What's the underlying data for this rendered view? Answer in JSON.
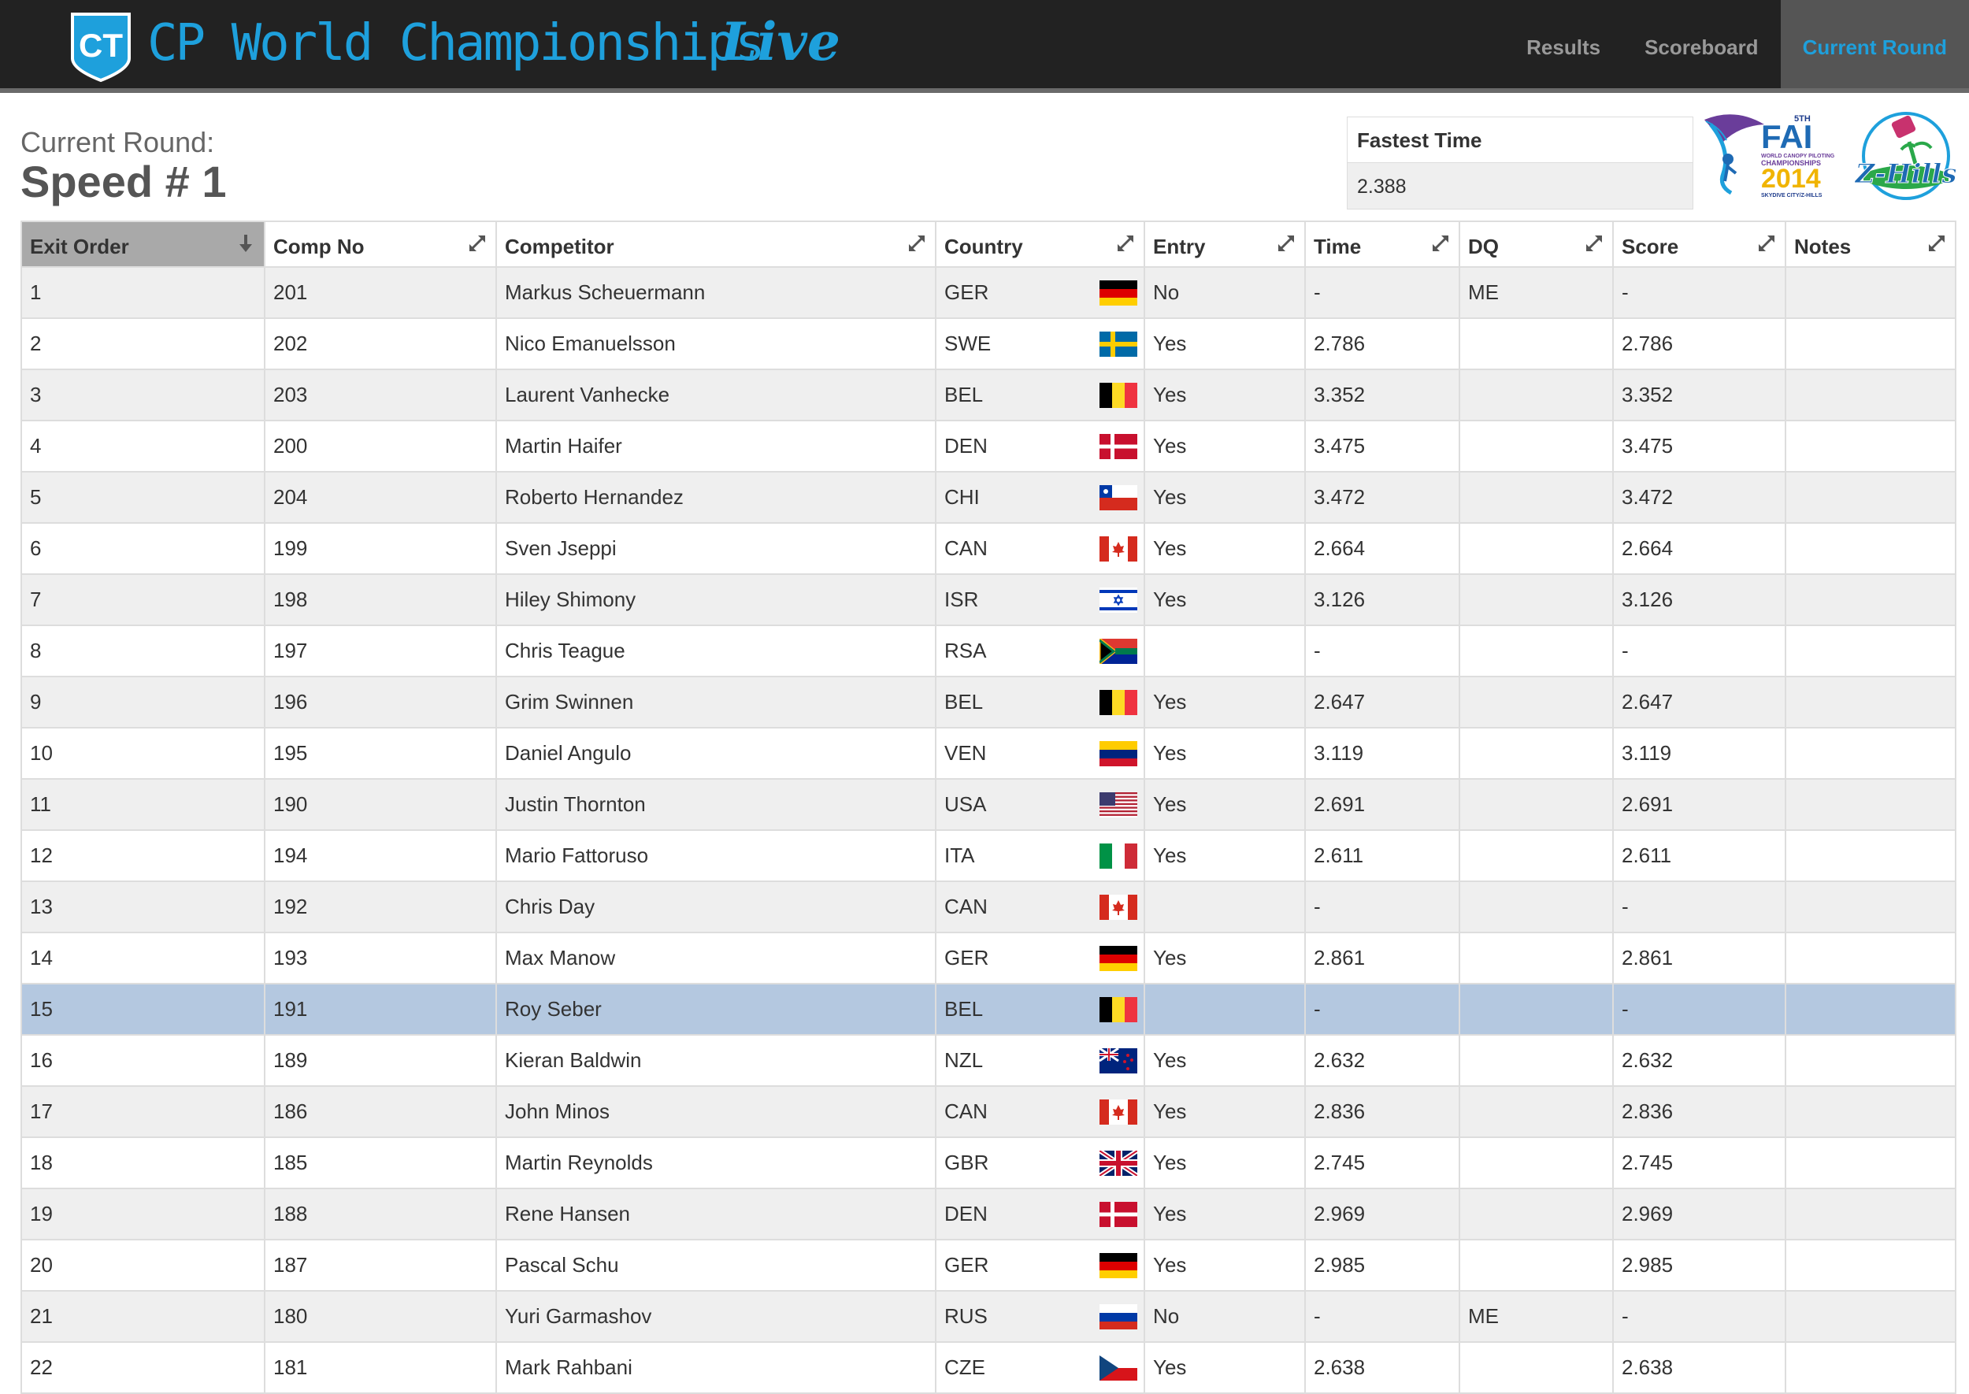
{
  "app": {
    "title": "CP World Championships",
    "title_accent": "Live",
    "logo_text": "CT",
    "nav": [
      {
        "label": "Results",
        "active": false
      },
      {
        "label": "Scoreboard",
        "active": false
      },
      {
        "label": "Current Round",
        "active": true
      }
    ]
  },
  "round": {
    "label": "Current Round:",
    "name": "Speed # 1"
  },
  "fastest": {
    "label": "Fastest Time",
    "value": "2.388"
  },
  "sponsors": {
    "fai": {
      "top": "5TH",
      "name": "FAI",
      "line1": "WORLD CANOPY PILOTING",
      "line2": "CHAMPIONSHIPS",
      "year": "2014",
      "line3": "SKYDIVE CITY/Z-HILLS"
    },
    "zhills": {
      "name": "Z-Hills"
    }
  },
  "table": {
    "columns": [
      {
        "label": "Exit Order",
        "icon": "sort-down-icon",
        "sorted": true
      },
      {
        "label": "Comp No",
        "icon": "resize-icon"
      },
      {
        "label": "Competitor",
        "icon": "resize-icon"
      },
      {
        "label": "Country",
        "icon": "resize-icon"
      },
      {
        "label": "Entry",
        "icon": "resize-icon"
      },
      {
        "label": "Time",
        "icon": "resize-icon"
      },
      {
        "label": "DQ",
        "icon": "resize-icon"
      },
      {
        "label": "Score",
        "icon": "resize-icon"
      },
      {
        "label": "Notes",
        "icon": "resize-icon"
      }
    ],
    "selected_row": 15,
    "rows": [
      {
        "exit": "1",
        "comp": "201",
        "name": "Markus Scheuermann",
        "country": "GER",
        "entry": "No",
        "time": "-",
        "dq": "ME",
        "score": "-",
        "notes": ""
      },
      {
        "exit": "2",
        "comp": "202",
        "name": "Nico Emanuelsson",
        "country": "SWE",
        "entry": "Yes",
        "time": "2.786",
        "dq": "",
        "score": "2.786",
        "notes": ""
      },
      {
        "exit": "3",
        "comp": "203",
        "name": "Laurent Vanhecke",
        "country": "BEL",
        "entry": "Yes",
        "time": "3.352",
        "dq": "",
        "score": "3.352",
        "notes": ""
      },
      {
        "exit": "4",
        "comp": "200",
        "name": "Martin Haifer",
        "country": "DEN",
        "entry": "Yes",
        "time": "3.475",
        "dq": "",
        "score": "3.475",
        "notes": ""
      },
      {
        "exit": "5",
        "comp": "204",
        "name": "Roberto Hernandez",
        "country": "CHI",
        "entry": "Yes",
        "time": "3.472",
        "dq": "",
        "score": "3.472",
        "notes": ""
      },
      {
        "exit": "6",
        "comp": "199",
        "name": "Sven Jseppi",
        "country": "CAN",
        "entry": "Yes",
        "time": "2.664",
        "dq": "",
        "score": "2.664",
        "notes": ""
      },
      {
        "exit": "7",
        "comp": "198",
        "name": "Hiley Shimony",
        "country": "ISR",
        "entry": "Yes",
        "time": "3.126",
        "dq": "",
        "score": "3.126",
        "notes": ""
      },
      {
        "exit": "8",
        "comp": "197",
        "name": "Chris Teague",
        "country": "RSA",
        "entry": "",
        "time": "-",
        "dq": "",
        "score": "-",
        "notes": ""
      },
      {
        "exit": "9",
        "comp": "196",
        "name": "Grim Swinnen",
        "country": "BEL",
        "entry": "Yes",
        "time": "2.647",
        "dq": "",
        "score": "2.647",
        "notes": ""
      },
      {
        "exit": "10",
        "comp": "195",
        "name": "Daniel Angulo",
        "country": "VEN",
        "entry": "Yes",
        "time": "3.119",
        "dq": "",
        "score": "3.119",
        "notes": ""
      },
      {
        "exit": "11",
        "comp": "190",
        "name": "Justin Thornton",
        "country": "USA",
        "entry": "Yes",
        "time": "2.691",
        "dq": "",
        "score": "2.691",
        "notes": ""
      },
      {
        "exit": "12",
        "comp": "194",
        "name": "Mario Fattoruso",
        "country": "ITA",
        "entry": "Yes",
        "time": "2.611",
        "dq": "",
        "score": "2.611",
        "notes": ""
      },
      {
        "exit": "13",
        "comp": "192",
        "name": "Chris Day",
        "country": "CAN",
        "entry": "",
        "time": "-",
        "dq": "",
        "score": "-",
        "notes": ""
      },
      {
        "exit": "14",
        "comp": "193",
        "name": "Max Manow",
        "country": "GER",
        "entry": "Yes",
        "time": "2.861",
        "dq": "",
        "score": "2.861",
        "notes": ""
      },
      {
        "exit": "15",
        "comp": "191",
        "name": "Roy Seber",
        "country": "BEL",
        "entry": "",
        "time": "-",
        "dq": "",
        "score": "-",
        "notes": ""
      },
      {
        "exit": "16",
        "comp": "189",
        "name": "Kieran Baldwin",
        "country": "NZL",
        "entry": "Yes",
        "time": "2.632",
        "dq": "",
        "score": "2.632",
        "notes": ""
      },
      {
        "exit": "17",
        "comp": "186",
        "name": "John Minos",
        "country": "CAN",
        "entry": "Yes",
        "time": "2.836",
        "dq": "",
        "score": "2.836",
        "notes": ""
      },
      {
        "exit": "18",
        "comp": "185",
        "name": "Martin Reynolds",
        "country": "GBR",
        "entry": "Yes",
        "time": "2.745",
        "dq": "",
        "score": "2.745",
        "notes": ""
      },
      {
        "exit": "19",
        "comp": "188",
        "name": "Rene Hansen",
        "country": "DEN",
        "entry": "Yes",
        "time": "2.969",
        "dq": "",
        "score": "2.969",
        "notes": ""
      },
      {
        "exit": "20",
        "comp": "187",
        "name": "Pascal Schu",
        "country": "GER",
        "entry": "Yes",
        "time": "2.985",
        "dq": "",
        "score": "2.985",
        "notes": ""
      },
      {
        "exit": "21",
        "comp": "180",
        "name": "Yuri Garmashov",
        "country": "RUS",
        "entry": "No",
        "time": "-",
        "dq": "ME",
        "score": "-",
        "notes": ""
      },
      {
        "exit": "22",
        "comp": "181",
        "name": "Mark Rahbani",
        "country": "CZE",
        "entry": "Yes",
        "time": "2.638",
        "dq": "",
        "score": "2.638",
        "notes": ""
      }
    ]
  },
  "colors": {
    "topbar": "#222222",
    "accent": "#1ea0dc",
    "nav_active_bg": "#555555",
    "row_odd": "#efefef",
    "row_selected": "#b4c8e0",
    "sorted_header": "#a9a9a9"
  }
}
